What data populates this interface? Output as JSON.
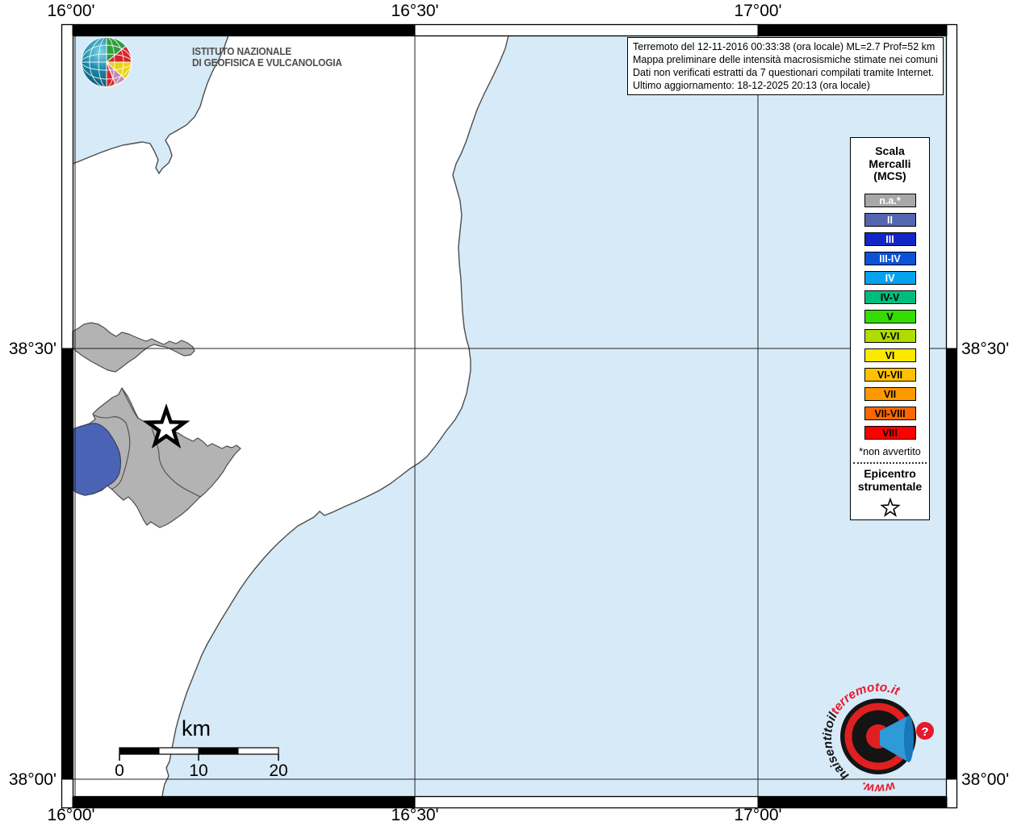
{
  "colors": {
    "sea": "#d7eaf7",
    "land": "#ffffff",
    "municipality_na": "#b3b3b3",
    "municipality_ii": "#4a63b5",
    "coastline": "#4d4d4d",
    "grid": "#222222"
  },
  "axis_labels": {
    "top": [
      "16°00'",
      "16°30'",
      "17°00'"
    ],
    "bottom": [
      "16°00'",
      "16°30'",
      "17°00'"
    ],
    "left": [
      "38°30'",
      "38°00'"
    ],
    "right": [
      "38°30'",
      "38°00'"
    ]
  },
  "info_box": {
    "lines": [
      "Terremoto del 12-11-2016 00:33:38 (ora locale) ML=2.7 Prof=52 km",
      "Mappa preliminare delle intensità macrosismiche stimate nei comuni",
      "Dati non verificati estratti da 7 questionari compilati tramite Internet.",
      "Ultimo aggiornamento: 18-12-2025 20:13 (ora locale)"
    ]
  },
  "ingv": {
    "line1": "ISTITUTO NAZIONALE",
    "line2": "DI GEOFISICA E VULCANOLOGIA"
  },
  "legend": {
    "title_lines": [
      "Scala",
      "Mercalli",
      "(MCS)"
    ],
    "items": [
      {
        "label": "n.a.*",
        "color": "#a8a8a8",
        "text": "#ffffff"
      },
      {
        "label": "II",
        "color": "#5366b0",
        "text": "#ffffff"
      },
      {
        "label": "III",
        "color": "#1226c8",
        "text": "#ffffff"
      },
      {
        "label": "III-IV",
        "color": "#0a52d8",
        "text": "#ffffff"
      },
      {
        "label": "IV",
        "color": "#06a2ee",
        "text": "#ffffff"
      },
      {
        "label": "IV-V",
        "color": "#00bd7e",
        "text": "#000000"
      },
      {
        "label": "V",
        "color": "#35dc00",
        "text": "#000000"
      },
      {
        "label": "V-VI",
        "color": "#b0dc00",
        "text": "#000000"
      },
      {
        "label": "VI",
        "color": "#ffe800",
        "text": "#000000"
      },
      {
        "label": "VI-VII",
        "color": "#ffc100",
        "text": "#000000"
      },
      {
        "label": "VII",
        "color": "#ff9900",
        "text": "#000000"
      },
      {
        "label": "VII-VIII",
        "color": "#ff6600",
        "text": "#000000"
      },
      {
        "label": "VIII",
        "color": "#ff0000",
        "text": "#000000"
      }
    ],
    "footnote": "*non avvertito",
    "epicenter_lines": [
      "Epicentro",
      "strumentale"
    ]
  },
  "scale_bar": {
    "unit": "km",
    "ticks": [
      "0",
      "10",
      "20"
    ]
  },
  "watermark": {
    "arc_black": "haisentitoil",
    "arc_red": "terremoto.it",
    "bottom": "www.",
    "badge": "?"
  }
}
